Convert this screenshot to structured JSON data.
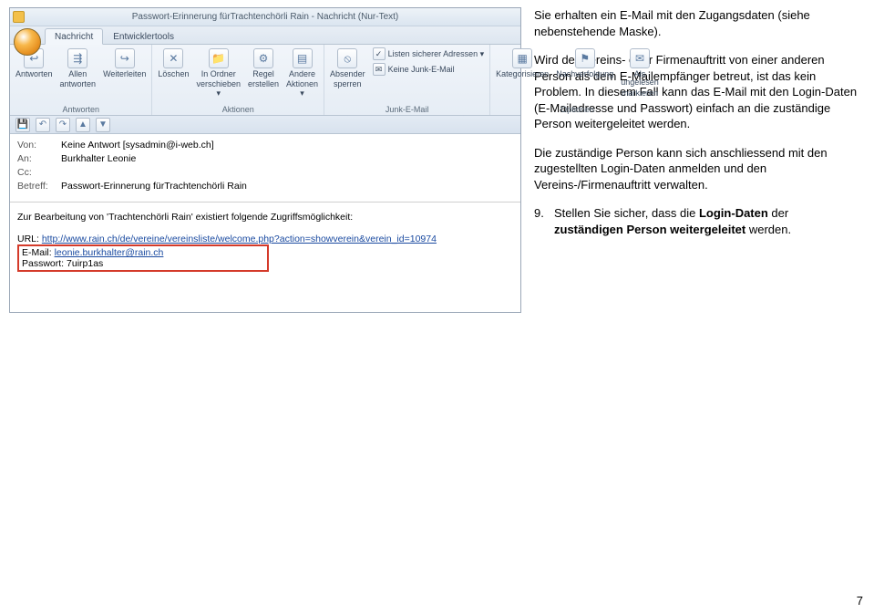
{
  "outlook": {
    "window_title": "Passwort-Erinnerung fürTrachtenchörli Rain - Nachricht (Nur-Text)",
    "tabs": {
      "message": "Nachricht",
      "devtools": "Entwicklertools"
    },
    "ribbon": {
      "reply": "Antworten",
      "reply_all_1": "Allen",
      "reply_all_2": "antworten",
      "forward": "Weiterleiten",
      "group_respond": "Antworten",
      "delete": "Löschen",
      "move_1": "In Ordner",
      "move_2": "verschieben ▾",
      "rule_1": "Regel",
      "rule_2": "erstellen",
      "other_1": "Andere",
      "other_2": "Aktionen ▾",
      "group_actions": "Aktionen",
      "block_1": "Absender",
      "block_2": "sperren",
      "safe_lists": "Listen sicherer Adressen ▾",
      "not_junk": "Keine Junk-E-Mail",
      "group_junk": "Junk-E-Mail",
      "categorize": "Kategorisieren",
      "followup": "Nachverfolgung",
      "unread_1": "Als ungelesen",
      "unread_2": "markieren",
      "group_options": "Optionen"
    },
    "headers": {
      "from_label": "Von:",
      "from_value": "Keine Antwort [sysadmin@i-web.ch]",
      "to_label": "An:",
      "to_value": "Burkhalter Leonie",
      "cc_label": "Cc:",
      "cc_value": "",
      "subject_label": "Betreff:",
      "subject_value": "Passwort-Erinnerung fürTrachtenchörli Rain"
    },
    "body": {
      "intro": "Zur Bearbeitung von 'Trachtenchörli Rain' existiert folgende Zugriffsmöglichkeit:",
      "url_label": "URL: ",
      "url": "http://www.rain.ch/de/vereine/vereinsliste/welcome.php?action=showverein&verein_id=10974",
      "email_label": "E-Mail: ",
      "email": "leonie.burkhalter@rain.ch",
      "password_label": "Passwort: ",
      "password": "7uirp1as"
    }
  },
  "instructions": {
    "p1": "Sie erhalten ein E-Mail mit den Zugangsdaten (siehe nebenstehende Maske).",
    "p2": "Wird der Vereins- oder Firmenauftritt von einer anderen Person als dem E-Mailempfänger betreut, ist das kein Problem. In diesem Fall kann das E-Mail mit den Login-Daten (E-Mailadresse und Passwort) einfach an die zuständige Person weitergeleitet werden.",
    "p3": "Die zuständige Person kann sich anschliessend mit den zugestellten Login-Daten anmelden und den Vereins-/Firmenauftritt verwalten.",
    "step_num": "9.",
    "step_text_1": "Stellen Sie sicher, dass die ",
    "step_bold_1": "Login-Daten",
    "step_text_2": " der ",
    "step_bold_2": "zuständigen Person weitergeleitet",
    "step_text_3": " werden."
  },
  "page_number": "7"
}
